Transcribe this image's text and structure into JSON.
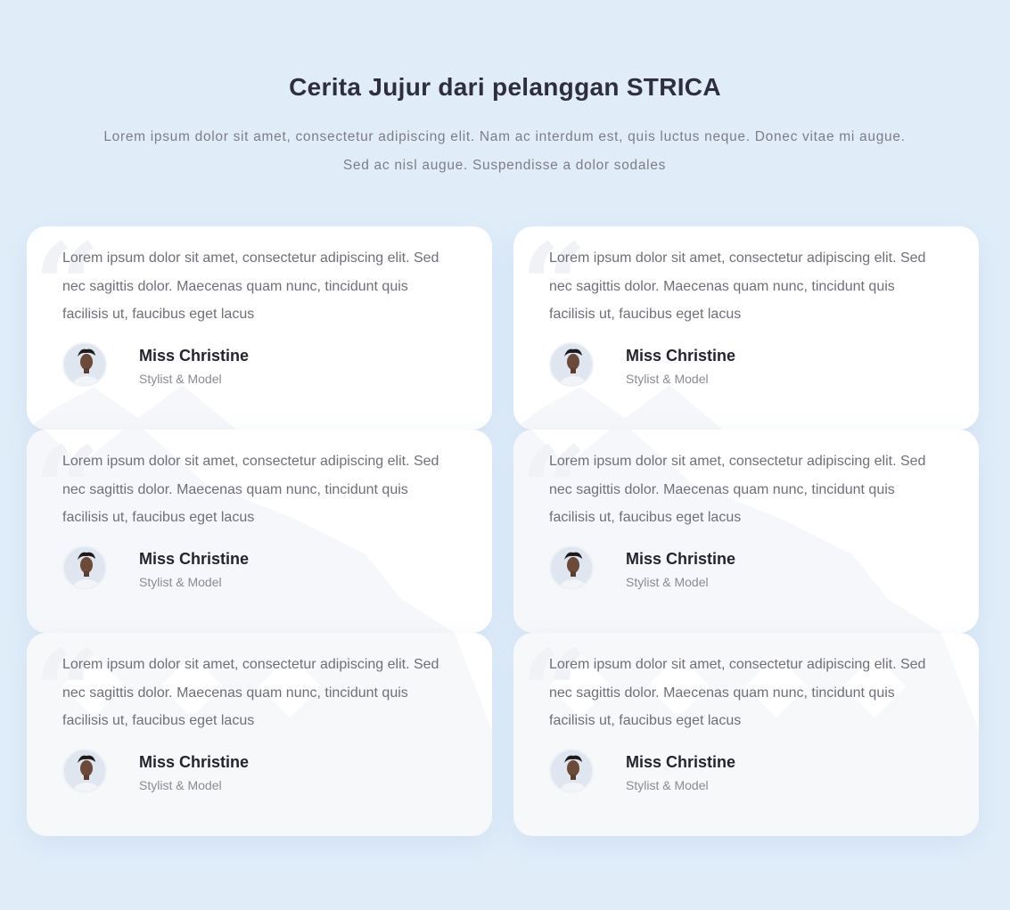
{
  "section": {
    "title": "Cerita Jujur dari pelanggan STRICA",
    "subtitle": "Lorem ipsum dolor sit amet, consectetur adipiscing elit. Nam ac interdum est, quis luctus neque. Donec vitae mi augue. Sed ac nisl augue. Suspendisse a dolor sodales"
  },
  "testimonials": [
    {
      "text": "Lorem ipsum dolor sit amet, consectetur adipiscing elit. Sed nec sagittis dolor. Maecenas quam nunc, tincidunt quis facilisis ut, faucibus eget lacus",
      "name": "Miss Christine",
      "role": "Stylist & Model",
      "avatar_icon": "person-avatar-icon"
    },
    {
      "text": "Lorem ipsum dolor sit amet, consectetur adipiscing elit. Sed nec sagittis dolor. Maecenas quam nunc, tincidunt quis facilisis ut, faucibus eget lacus",
      "name": "Miss Christine",
      "role": "Stylist & Model",
      "avatar_icon": "person-avatar-icon"
    },
    {
      "text": "Lorem ipsum dolor sit amet, consectetur adipiscing elit. Sed nec sagittis dolor. Maecenas quam nunc, tincidunt quis facilisis ut, faucibus eget lacus",
      "name": "Miss Christine",
      "role": "Stylist & Model",
      "avatar_icon": "person-avatar-icon"
    },
    {
      "text": "Lorem ipsum dolor sit amet, consectetur adipiscing elit. Sed nec sagittis dolor. Maecenas quam nunc, tincidunt quis facilisis ut, faucibus eget lacus",
      "name": "Miss Christine",
      "role": "Stylist & Model",
      "avatar_icon": "person-avatar-icon"
    },
    {
      "text": "Lorem ipsum dolor sit amet, consectetur adipiscing elit. Sed nec sagittis dolor. Maecenas quam nunc, tincidunt quis facilisis ut, faucibus eget lacus",
      "name": "Miss Christine",
      "role": "Stylist & Model",
      "avatar_icon": "person-avatar-icon"
    },
    {
      "text": "Lorem ipsum dolor sit amet, consectetur adipiscing elit. Sed nec sagittis dolor. Maecenas quam nunc, tincidunt quis facilisis ut, faucibus eget lacus",
      "name": "Miss Christine",
      "role": "Stylist & Model",
      "avatar_icon": "person-avatar-icon"
    }
  ],
  "colors": {
    "page_background": "#e0edf9",
    "card_background": "#ffffff",
    "title": "#2e2e3d",
    "body_text": "#6f6f78"
  }
}
